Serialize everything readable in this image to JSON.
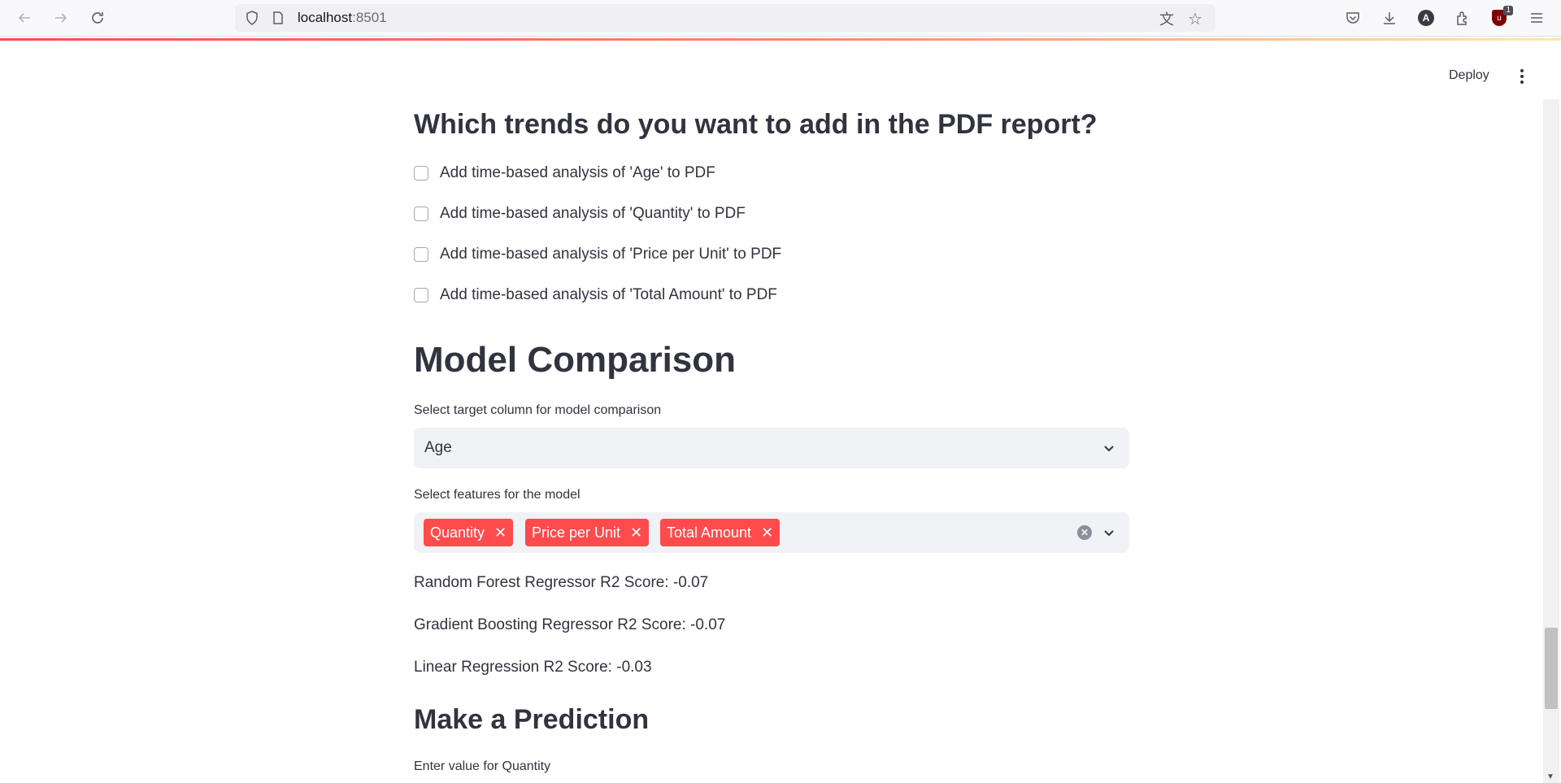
{
  "browser": {
    "url_host": "localhost",
    "url_port": ":8501",
    "extension_badge": "1",
    "account_initial": "A"
  },
  "header": {
    "deploy_label": "Deploy"
  },
  "trends": {
    "heading": "Which trends do you want to add in the PDF report?",
    "options": [
      {
        "label": "Add time-based analysis of 'Age' to PDF",
        "checked": false
      },
      {
        "label": "Add time-based analysis of 'Quantity' to PDF",
        "checked": false
      },
      {
        "label": "Add time-based analysis of 'Price per Unit' to PDF",
        "checked": false
      },
      {
        "label": "Add time-based analysis of 'Total Amount' to PDF",
        "checked": false
      }
    ]
  },
  "model_comparison": {
    "heading": "Model Comparison",
    "target_label": "Select target column for model comparison",
    "target_value": "Age",
    "features_label": "Select features for the model",
    "features": [
      "Quantity",
      "Price per Unit",
      "Total Amount"
    ],
    "results": [
      "Random Forest Regressor R2 Score: -0.07",
      "Gradient Boosting Regressor R2 Score: -0.07",
      "Linear Regression R2 Score: -0.03"
    ]
  },
  "prediction": {
    "heading": "Make a Prediction",
    "input_label": "Enter value for Quantity"
  },
  "colors": {
    "accent": "#ff4b4b",
    "input_bg": "#f0f2f6",
    "text": "#31333f"
  }
}
